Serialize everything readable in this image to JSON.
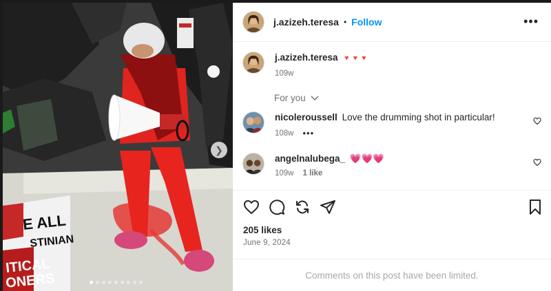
{
  "post": {
    "username": "j.azizeh.teresa",
    "follow_label": "Follow",
    "separator": "•",
    "more_label": "•••",
    "caption": "🔻🔻🔻",
    "caption_time": "109w",
    "for_you_label": "For you",
    "likes": "205 likes",
    "date": "June 9, 2024",
    "comments_limited": "Comments on this post have been limited."
  },
  "comments": [
    {
      "username": "nicoleroussell",
      "text": "Love the drumming shot in particular!",
      "time": "108w",
      "options": "•••"
    },
    {
      "username": "angelnalubega_",
      "text": "💗💗💗",
      "time": "109w",
      "likes": "1 like"
    }
  ],
  "carousel": {
    "slide_count": 9,
    "active_index": 0
  },
  "icons": {
    "like": "heart-outline-icon",
    "comment": "speech-bubble-icon",
    "share": "repost-icon",
    "send": "paper-plane-icon",
    "save": "bookmark-icon",
    "next": "chevron-right-icon",
    "dropdown": "chevron-down-icon"
  },
  "colors": {
    "follow": "#0095f6",
    "hearts": "#e0245e",
    "muted": "#737373"
  }
}
